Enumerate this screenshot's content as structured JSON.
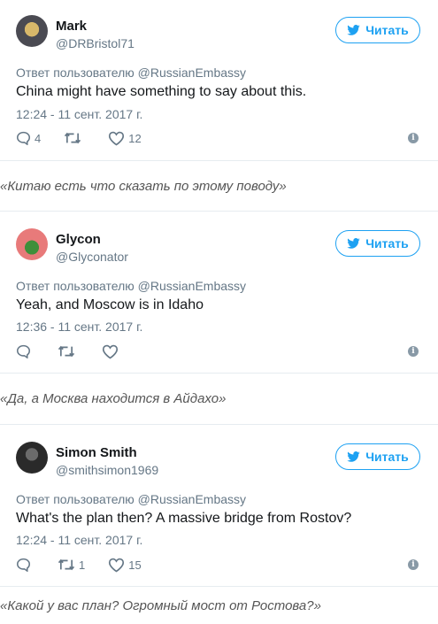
{
  "colors": {
    "accent": "#1da1f2",
    "muted": "#657786",
    "text": "#14171a"
  },
  "icons": {
    "follow": "twitter-bird-icon",
    "reply": "reply-icon",
    "retweet": "retweet-icon",
    "like": "heart-icon",
    "info": "info-icon"
  },
  "tweets": [
    {
      "name": "Mark",
      "handle": "@DRBristol71",
      "follow_label": "Читать",
      "reply_to": "Ответ пользователю @RussianEmbassy",
      "text": "China might have something to say about this.",
      "time": "12:24 - 11 сент. 2017 г.",
      "replies": "4",
      "retweets": "",
      "likes": "12",
      "translation": "«Китаю есть что сказать по этому поводу»"
    },
    {
      "name": "Glycon",
      "handle": "@Glyconator",
      "follow_label": "Читать",
      "reply_to": "Ответ пользователю @RussianEmbassy",
      "text": "Yeah, and Moscow is in Idaho",
      "time": "12:36 - 11 сент. 2017 г.",
      "replies": "",
      "retweets": "",
      "likes": "",
      "translation": "«Да, а Москва находится в Айдахо»"
    },
    {
      "name": "Simon Smith",
      "handle": "@smithsimon1969",
      "follow_label": "Читать",
      "reply_to": "Ответ пользователю @RussianEmbassy",
      "text": "What's the plan then? A massive bridge from Rostov?",
      "time": "12:24 - 11 сент. 2017 г.",
      "replies": "",
      "retweets": "1",
      "likes": "15",
      "translation": "«Какой у вас план? Огромный мост от Ростова?»"
    }
  ]
}
